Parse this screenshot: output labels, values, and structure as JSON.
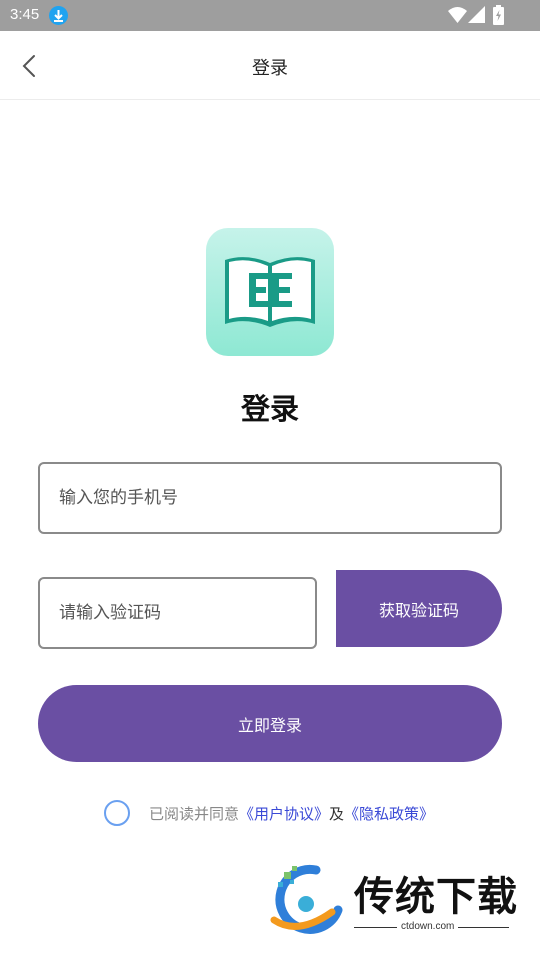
{
  "status_bar": {
    "time": "3:45",
    "icons": [
      "download-notification-icon",
      "wifi-icon",
      "cellular-signal-icon",
      "battery-icon"
    ]
  },
  "nav": {
    "title": "登录",
    "back_icon": "chevron-left-icon"
  },
  "logo": {
    "icon": "open-book-icon",
    "letters": "EE"
  },
  "heading": "登录",
  "phone_input": {
    "placeholder": "输入您的手机号",
    "value": ""
  },
  "code_input": {
    "placeholder": "请输入验证码",
    "value": ""
  },
  "get_code_button": "获取验证码",
  "login_button": "立即登录",
  "agreement": {
    "checked": false,
    "prefix": "已阅读并同意",
    "user_agreement": "《用户协议》",
    "and": "及",
    "privacy_policy": "《隐私政策》"
  },
  "watermark": {
    "brand": "传统下载",
    "url": "ctdown.com"
  },
  "colors": {
    "accent": "#6a4fa3",
    "link": "#3a49d6",
    "status_bar": "#9e9e9e",
    "logo_bg": "#a8efdf",
    "logo_book": "#1a9b87"
  }
}
